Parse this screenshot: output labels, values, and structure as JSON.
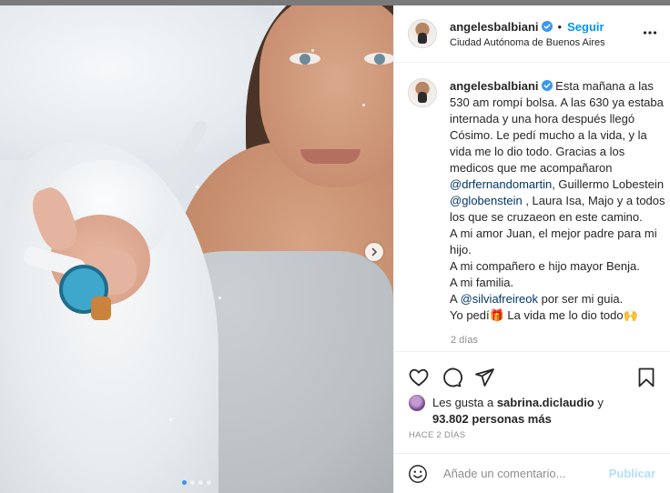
{
  "header": {
    "username": "angelesbalbiani",
    "follow_label": "Seguir",
    "separator": "•",
    "location": "Ciudad Autónoma de Buenos Aires"
  },
  "caption": {
    "username": "angelesbalbiani",
    "p1": " Esta mañana a las 530 am rompí bolsa. A las 630 ya estaba internada y una hora después llegó Cósimo. Le pedí mucho a la vida, y la vida me lo dio todo. Gracias a los medicos que me acompañaron ",
    "m1": "@drfernandomartin",
    "p2": ", Guillermo Lobestein ",
    "m2": "@globenstein",
    "p3": " , Laura Isa, Majo y a todos los que se cruzaeon en este camino.\nA mi amor Juan, el mejor padre para mi hijo.\nA mi compañero e hijo mayor Benja.\nA mi familia.\nA ",
    "m3": "@silviafreireok",
    "p4": " por ser mi guia.\nYo pedí",
    "e1": "🎁",
    "p5": " La vida me lo dio todo",
    "e2": "🙌",
    "time": "2 días"
  },
  "likes": {
    "prefix": "Les gusta a ",
    "user": "sabrina.diclaudio",
    "middle": " y",
    "count_text": "93.802 personas más"
  },
  "post_age": "HACE 2 DÍAS",
  "comment": {
    "placeholder": "Añade un comentario...",
    "publish_label": "Publicar"
  },
  "carousel": {
    "slides": 4,
    "active_index": 0
  },
  "colors": {
    "accent": "#0095f6",
    "verified": "#3897f0",
    "mention": "#00376b",
    "active_dot": "#3b8ff6",
    "publish_disabled": "#b2dffc"
  },
  "icons": [
    "verified-badge-icon",
    "more-options-icon",
    "heart-icon",
    "comment-icon",
    "share-icon",
    "bookmark-icon",
    "emoji-icon",
    "chevron-right-icon"
  ]
}
